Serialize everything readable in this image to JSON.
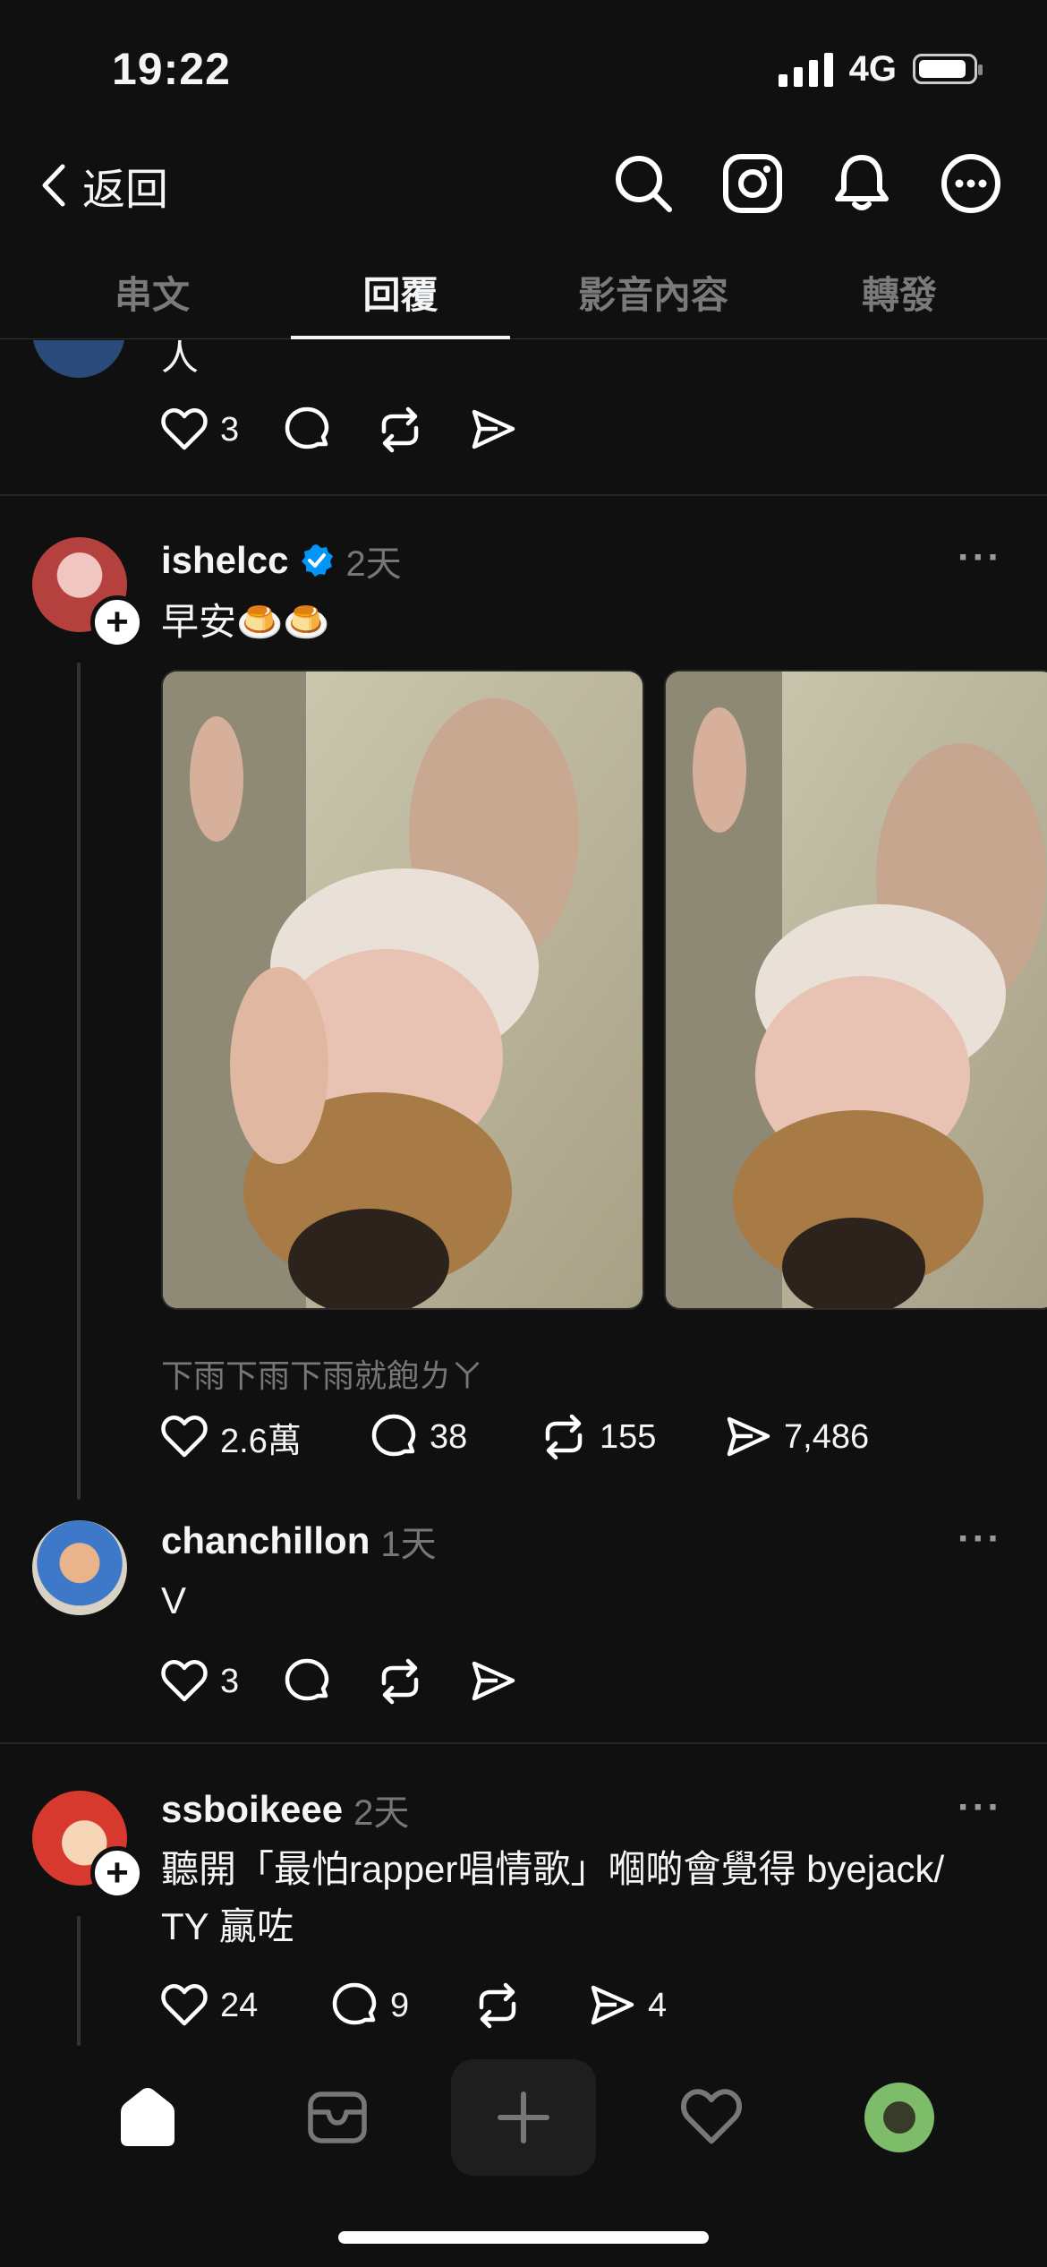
{
  "status_bar": {
    "time": "19:22",
    "network": "4G"
  },
  "header": {
    "back_label": "返回"
  },
  "tabs": [
    {
      "label": "串文"
    },
    {
      "label": "回覆"
    },
    {
      "label": "影音內容"
    },
    {
      "label": "轉發"
    }
  ],
  "posts": [
    {
      "text": "人",
      "likes": "3"
    },
    {
      "username": "ishelcc",
      "verified": true,
      "time": "2天",
      "text": "早安🍮🍮",
      "caption": "下雨下雨下雨就飽ㄌㄚ",
      "likes": "2.6萬",
      "replies": "38",
      "reposts": "155",
      "shares": "7,486"
    },
    {
      "username": "chanchillon",
      "time": "1天",
      "text": "V",
      "likes": "3"
    },
    {
      "username": "ssboikeee",
      "time": "2天",
      "text_line1": "聽開「最怕rapper唱情歌」嗰啲會覺得 byejack/",
      "text_line2": "TY 贏咗",
      "likes": "24",
      "replies": "9",
      "shares": "4"
    }
  ],
  "icons": [
    "chevron-left-icon",
    "search-icon",
    "instagram-icon",
    "bell-icon",
    "more-circle-icon",
    "heart-icon",
    "comment-icon",
    "repost-icon",
    "share-icon",
    "home-icon",
    "inbox-icon",
    "plus-icon",
    "activity-icon",
    "profile-avatar"
  ],
  "colors": {
    "background": "#101010",
    "verified": "#0095f6",
    "muted": "#777777"
  }
}
